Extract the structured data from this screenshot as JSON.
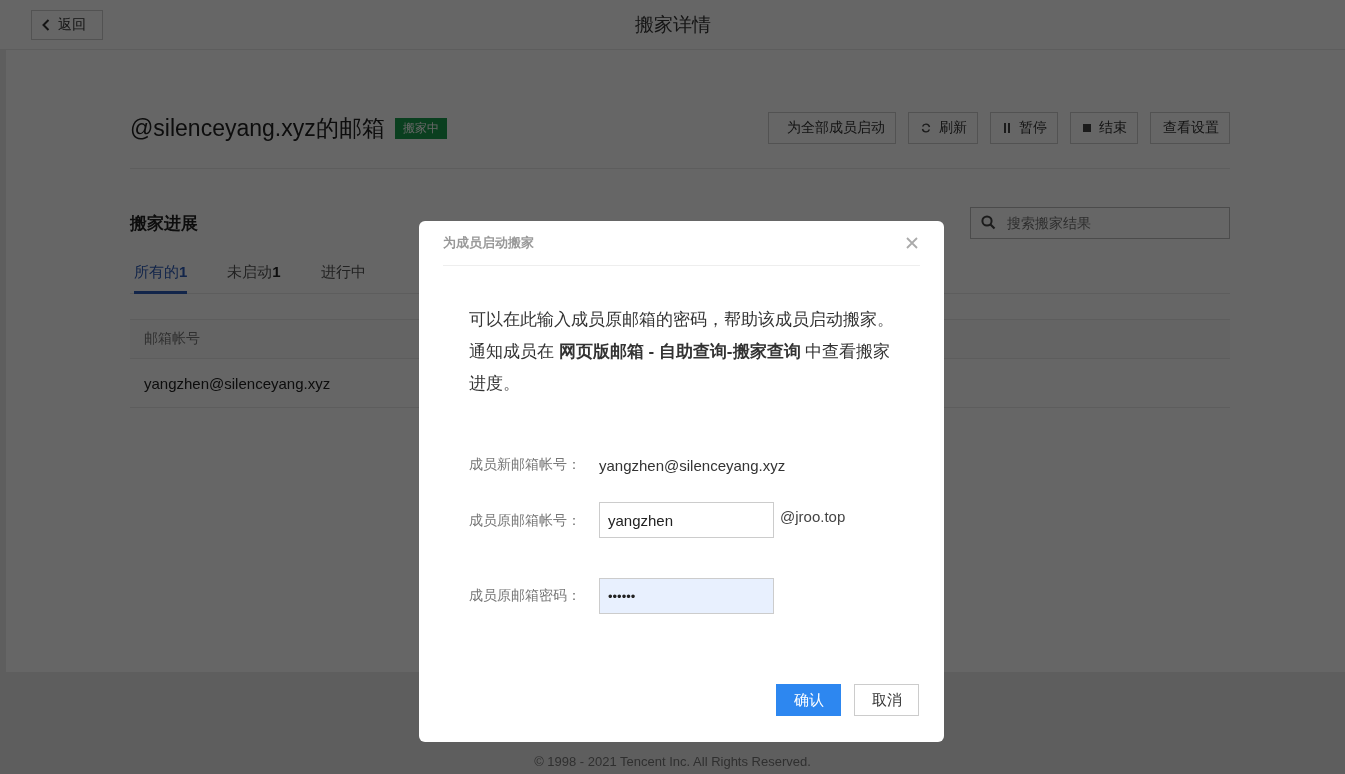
{
  "header": {
    "back_button": "返回",
    "title": "搬家详情"
  },
  "mailbox": {
    "title": "@silenceyang.xyz的邮箱",
    "status": "搬家中"
  },
  "actions": [
    {
      "kind": "plain",
      "label": "为全部成员启动"
    },
    {
      "kind": "refresh",
      "label": "刷新"
    },
    {
      "kind": "pause",
      "label": "暂停"
    },
    {
      "kind": "stop",
      "label": "结束"
    },
    {
      "kind": "plain",
      "label": "查看设置"
    }
  ],
  "progress": {
    "heading": "搬家进展",
    "search": {
      "placeholder": "搜索搬家结果"
    },
    "tabs": [
      {
        "label": "所有的",
        "count": "1",
        "selected": true
      },
      {
        "label": "未启动",
        "count": "1",
        "selected": false
      },
      {
        "label": "进行中",
        "selected": false
      }
    ],
    "table": {
      "columns": [
        "邮箱帐号"
      ],
      "rows": [
        {
          "account": "yangzhen@silenceyang.xyz"
        }
      ]
    }
  },
  "footer": "© 1998 - 2021 Tencent Inc. All Rights Reserved.",
  "dialog": {
    "title": "为成员启动搬家",
    "message": "可以在此输入成员原邮箱的密码，帮助该成员启动搬家。通知成员在 **网页版邮箱 - 自助查询-搬家查询** 中查看搬家进度。",
    "new_account": {
      "label": "成员新邮箱帐号：",
      "value": "yangzhen@silenceyang.xyz"
    },
    "old_account": {
      "label": "成员原邮箱帐号：",
      "value": "yangzhen",
      "suffix": "@jroo.top"
    },
    "password": {
      "label": "成员原邮箱密码：",
      "value": "••••••"
    },
    "buttons": [
      {
        "kind": "primary",
        "label": "确认"
      },
      {
        "kind": "secondary",
        "label": "取消"
      }
    ]
  }
}
